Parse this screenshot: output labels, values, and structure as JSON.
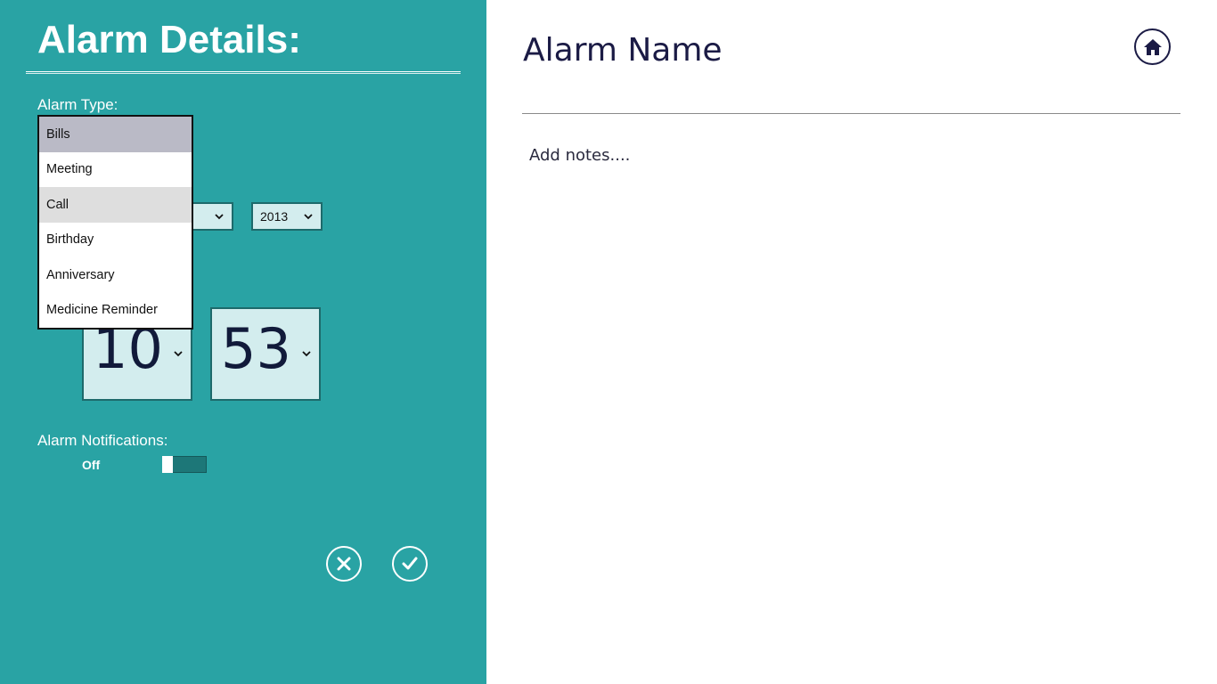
{
  "left_panel": {
    "title": "Alarm Details:",
    "alarm_type_label": "Alarm Type:",
    "alarm_type_options": [
      "Bills",
      "Meeting",
      "Call",
      "Birthday",
      "Anniversary",
      "Medicine Reminder"
    ],
    "alarm_type_selected": "Bills",
    "date": {
      "year": "2013"
    },
    "time": {
      "hour": "10",
      "minute": "53"
    },
    "notifications_label": "Alarm Notifications:",
    "notifications_state": "Off",
    "buttons": {
      "cancel_icon": "close-icon",
      "confirm_icon": "checkmark-icon"
    }
  },
  "main": {
    "alarm_name": "Alarm Name",
    "notes_placeholder": "Add notes....",
    "home_icon": "home-icon"
  },
  "colors": {
    "panel_bg": "#29a3a4",
    "control_bg": "#d3edee",
    "text_dark": "#1b1b45",
    "selected_item": "#babac6"
  }
}
